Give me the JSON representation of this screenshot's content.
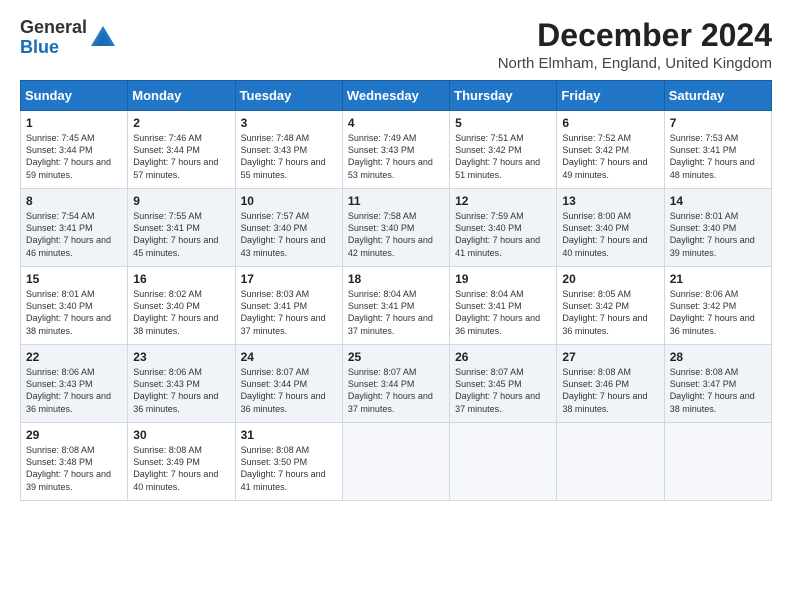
{
  "logo": {
    "general": "General",
    "blue": "Blue"
  },
  "header": {
    "title": "December 2024",
    "subtitle": "North Elmham, England, United Kingdom"
  },
  "weekdays": [
    "Sunday",
    "Monday",
    "Tuesday",
    "Wednesday",
    "Thursday",
    "Friday",
    "Saturday"
  ],
  "weeks": [
    [
      {
        "day": "1",
        "sunrise": "7:45 AM",
        "sunset": "3:44 PM",
        "daylight": "7 hours and 59 minutes."
      },
      {
        "day": "2",
        "sunrise": "7:46 AM",
        "sunset": "3:44 PM",
        "daylight": "7 hours and 57 minutes."
      },
      {
        "day": "3",
        "sunrise": "7:48 AM",
        "sunset": "3:43 PM",
        "daylight": "7 hours and 55 minutes."
      },
      {
        "day": "4",
        "sunrise": "7:49 AM",
        "sunset": "3:43 PM",
        "daylight": "7 hours and 53 minutes."
      },
      {
        "day": "5",
        "sunrise": "7:51 AM",
        "sunset": "3:42 PM",
        "daylight": "7 hours and 51 minutes."
      },
      {
        "day": "6",
        "sunrise": "7:52 AM",
        "sunset": "3:42 PM",
        "daylight": "7 hours and 49 minutes."
      },
      {
        "day": "7",
        "sunrise": "7:53 AM",
        "sunset": "3:41 PM",
        "daylight": "7 hours and 48 minutes."
      }
    ],
    [
      {
        "day": "8",
        "sunrise": "7:54 AM",
        "sunset": "3:41 PM",
        "daylight": "7 hours and 46 minutes."
      },
      {
        "day": "9",
        "sunrise": "7:55 AM",
        "sunset": "3:41 PM",
        "daylight": "7 hours and 45 minutes."
      },
      {
        "day": "10",
        "sunrise": "7:57 AM",
        "sunset": "3:40 PM",
        "daylight": "7 hours and 43 minutes."
      },
      {
        "day": "11",
        "sunrise": "7:58 AM",
        "sunset": "3:40 PM",
        "daylight": "7 hours and 42 minutes."
      },
      {
        "day": "12",
        "sunrise": "7:59 AM",
        "sunset": "3:40 PM",
        "daylight": "7 hours and 41 minutes."
      },
      {
        "day": "13",
        "sunrise": "8:00 AM",
        "sunset": "3:40 PM",
        "daylight": "7 hours and 40 minutes."
      },
      {
        "day": "14",
        "sunrise": "8:01 AM",
        "sunset": "3:40 PM",
        "daylight": "7 hours and 39 minutes."
      }
    ],
    [
      {
        "day": "15",
        "sunrise": "8:01 AM",
        "sunset": "3:40 PM",
        "daylight": "7 hours and 38 minutes."
      },
      {
        "day": "16",
        "sunrise": "8:02 AM",
        "sunset": "3:40 PM",
        "daylight": "7 hours and 38 minutes."
      },
      {
        "day": "17",
        "sunrise": "8:03 AM",
        "sunset": "3:41 PM",
        "daylight": "7 hours and 37 minutes."
      },
      {
        "day": "18",
        "sunrise": "8:04 AM",
        "sunset": "3:41 PM",
        "daylight": "7 hours and 37 minutes."
      },
      {
        "day": "19",
        "sunrise": "8:04 AM",
        "sunset": "3:41 PM",
        "daylight": "7 hours and 36 minutes."
      },
      {
        "day": "20",
        "sunrise": "8:05 AM",
        "sunset": "3:42 PM",
        "daylight": "7 hours and 36 minutes."
      },
      {
        "day": "21",
        "sunrise": "8:06 AM",
        "sunset": "3:42 PM",
        "daylight": "7 hours and 36 minutes."
      }
    ],
    [
      {
        "day": "22",
        "sunrise": "8:06 AM",
        "sunset": "3:43 PM",
        "daylight": "7 hours and 36 minutes."
      },
      {
        "day": "23",
        "sunrise": "8:06 AM",
        "sunset": "3:43 PM",
        "daylight": "7 hours and 36 minutes."
      },
      {
        "day": "24",
        "sunrise": "8:07 AM",
        "sunset": "3:44 PM",
        "daylight": "7 hours and 36 minutes."
      },
      {
        "day": "25",
        "sunrise": "8:07 AM",
        "sunset": "3:44 PM",
        "daylight": "7 hours and 37 minutes."
      },
      {
        "day": "26",
        "sunrise": "8:07 AM",
        "sunset": "3:45 PM",
        "daylight": "7 hours and 37 minutes."
      },
      {
        "day": "27",
        "sunrise": "8:08 AM",
        "sunset": "3:46 PM",
        "daylight": "7 hours and 38 minutes."
      },
      {
        "day": "28",
        "sunrise": "8:08 AM",
        "sunset": "3:47 PM",
        "daylight": "7 hours and 38 minutes."
      }
    ],
    [
      {
        "day": "29",
        "sunrise": "8:08 AM",
        "sunset": "3:48 PM",
        "daylight": "7 hours and 39 minutes."
      },
      {
        "day": "30",
        "sunrise": "8:08 AM",
        "sunset": "3:49 PM",
        "daylight": "7 hours and 40 minutes."
      },
      {
        "day": "31",
        "sunrise": "8:08 AM",
        "sunset": "3:50 PM",
        "daylight": "7 hours and 41 minutes."
      },
      null,
      null,
      null,
      null
    ]
  ],
  "labels": {
    "sunrise": "Sunrise:",
    "sunset": "Sunset:",
    "daylight": "Daylight:"
  }
}
